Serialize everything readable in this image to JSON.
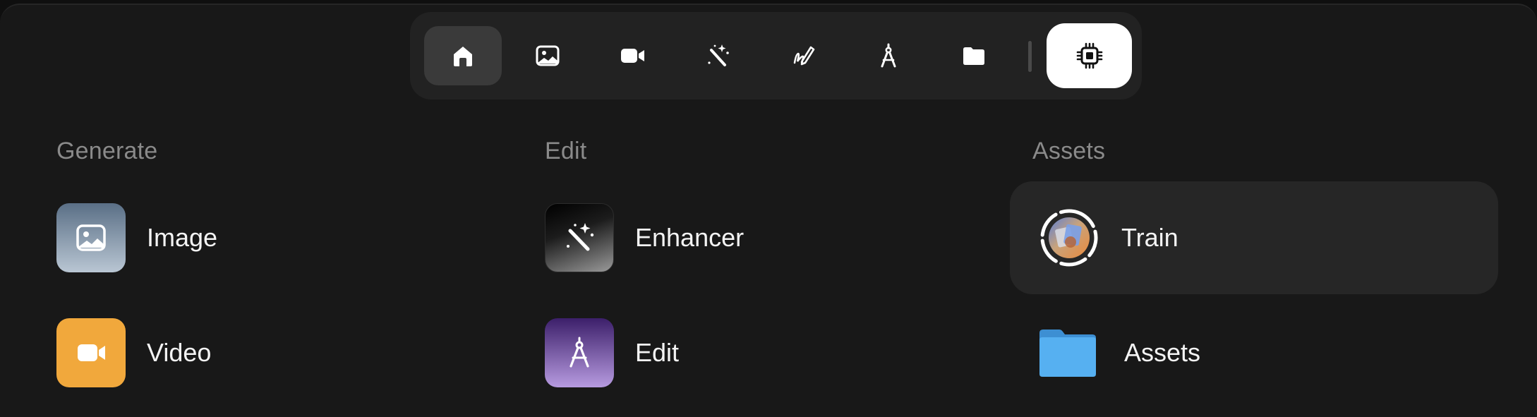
{
  "toolbar": {
    "items": [
      {
        "icon": "home-icon",
        "active": true
      },
      {
        "icon": "image-icon",
        "active": false
      },
      {
        "icon": "video-camera-icon",
        "active": false
      },
      {
        "icon": "magic-wand-icon",
        "active": false
      },
      {
        "icon": "pen-scribble-icon",
        "active": false
      },
      {
        "icon": "compass-icon",
        "active": false
      },
      {
        "icon": "folder-icon",
        "active": false
      },
      {
        "icon": "chip-icon",
        "active": false,
        "featured": true
      }
    ]
  },
  "sections": {
    "generate": {
      "title": "Generate",
      "items": [
        {
          "label": "Image",
          "icon": "image-icon",
          "color": "#5a6f86"
        },
        {
          "label": "Video",
          "icon": "video-camera-icon",
          "color": "#f1a83c"
        }
      ]
    },
    "edit": {
      "title": "Edit",
      "items": [
        {
          "label": "Enhancer",
          "icon": "magic-wand-icon",
          "color": "#000000"
        },
        {
          "label": "Edit",
          "icon": "compass-icon",
          "color": "#6a44a8"
        }
      ]
    },
    "assets": {
      "title": "Assets",
      "items": [
        {
          "label": "Train",
          "icon": "train-progress-icon",
          "selected": true
        },
        {
          "label": "Assets",
          "icon": "folder-icon",
          "color": "#4aa8ee"
        }
      ]
    }
  },
  "colors": {
    "background": "#181818",
    "toolbar": "#222222",
    "active_tab": "#3a3a3a",
    "section_title": "#8a8a8a",
    "selected_item": "#262626"
  }
}
